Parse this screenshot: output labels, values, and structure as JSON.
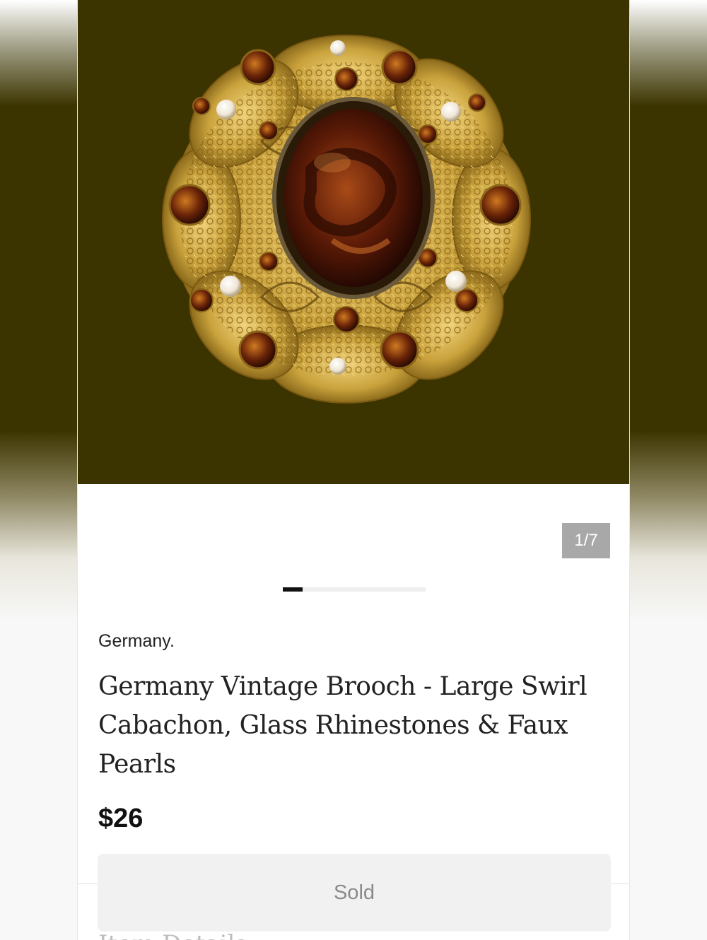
{
  "gallery": {
    "counter": "1/7",
    "current_image": 1,
    "total_images": 7,
    "progress_fraction": 0.14
  },
  "product": {
    "brand": "Germany.",
    "title": "Germany Vintage Brooch - Large Swirl Cabachon, Glass Rhinestones & Faux Pearls",
    "price": "$26"
  },
  "actions": {
    "sold_label": "Sold"
  },
  "sections": {
    "item_details_heading": "Item Details"
  },
  "colors": {
    "photo_background": "#3c3400",
    "gold": "#c9a23c",
    "amber_stone": "#7a2e08",
    "pearl": "#f4efe6"
  }
}
